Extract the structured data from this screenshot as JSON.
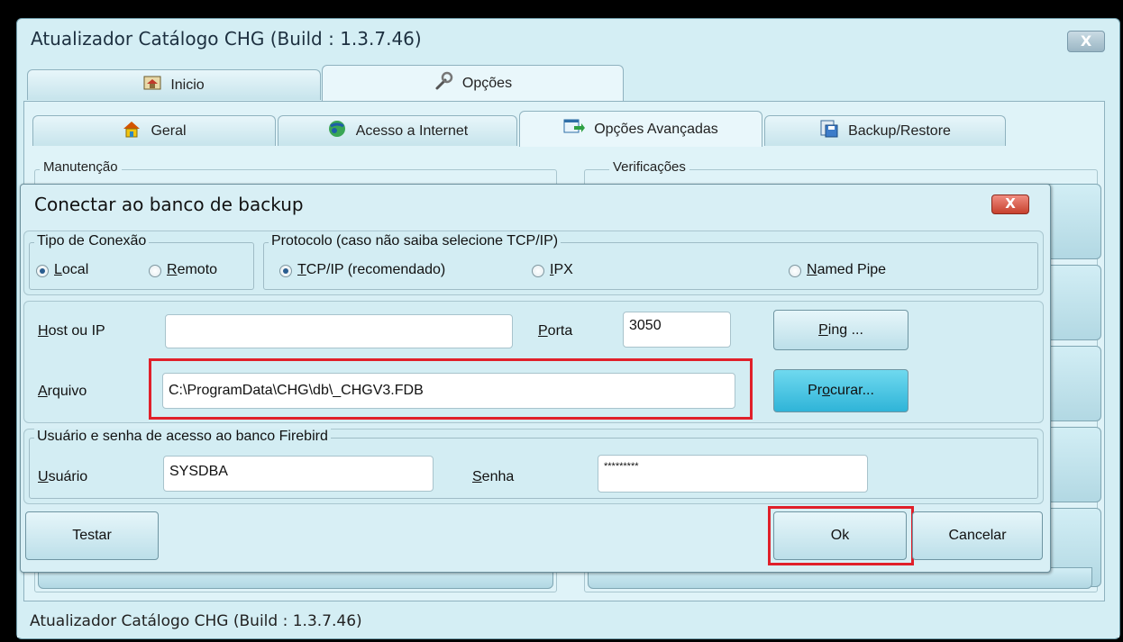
{
  "app": {
    "title": "Atualizador Catálogo CHG  (Build : 1.3.7.46)",
    "close_label": "X"
  },
  "top_tabs": [
    {
      "label": "Inicio",
      "icon": "home-icon"
    },
    {
      "label": "Opções",
      "icon": "wrench-icon"
    }
  ],
  "sub_tabs": [
    {
      "label": "Geral",
      "icon": "house-icon"
    },
    {
      "label": "Acesso a Internet",
      "icon": "globe-icon"
    },
    {
      "label": "Opções Avançadas",
      "icon": "arrow-window-icon"
    },
    {
      "label": "Backup/Restore",
      "icon": "backup-disk-icon"
    }
  ],
  "background_groups": {
    "maintenance": "Manutenção",
    "verifications": "Verificações"
  },
  "dialog": {
    "title": "Conectar ao banco de backup",
    "close_label": "X",
    "connection_type": {
      "legend": "Tipo de Conexão",
      "options": [
        {
          "label": "Local",
          "accel": "L",
          "rest": "ocal",
          "checked": true
        },
        {
          "label": "Remoto",
          "accel": "R",
          "rest": "emoto",
          "checked": false
        }
      ]
    },
    "protocol": {
      "legend": "Protocolo (caso não saiba selecione TCP/IP)",
      "options": [
        {
          "label": "TCP/IP (recomendado)",
          "accel": "T",
          "rest": "CP/IP (recomendado)",
          "checked": true
        },
        {
          "label": "IPX",
          "accel": "I",
          "rest": "PX",
          "checked": false
        },
        {
          "label": "Named Pipe",
          "accel": "N",
          "rest": "amed Pipe",
          "checked": false
        }
      ]
    },
    "host": {
      "accel": "H",
      "rest": "ost ou IP",
      "value": ""
    },
    "port": {
      "accel": "P",
      "rest": "orta",
      "value": "3050"
    },
    "ping_button": {
      "accel": "P",
      "rest": "ing ..."
    },
    "file": {
      "accel": "A",
      "rest": "rquivo",
      "value": "C:\\ProgramData\\CHG\\db\\_CHGV3.FDB"
    },
    "browse_button": {
      "pre": "Pr",
      "accel": "o",
      "rest": "curar..."
    },
    "credentials": {
      "legend": "Usuário e senha de acesso ao banco Firebird",
      "user": {
        "accel": "U",
        "rest": "suário",
        "value": "SYSDBA"
      },
      "password": {
        "accel": "S",
        "rest": "enha",
        "value": "*********"
      }
    },
    "buttons": {
      "test": "Testar",
      "ok": "Ok",
      "cancel": "Cancelar"
    }
  },
  "status_bar": {
    "text": "Atualizador Catálogo CHG  (Build : 1.3.7.46)"
  },
  "colors": {
    "window_bg": "#d4eef4",
    "highlight_red": "#e0202a",
    "browse_button": "#2fb4d8"
  }
}
